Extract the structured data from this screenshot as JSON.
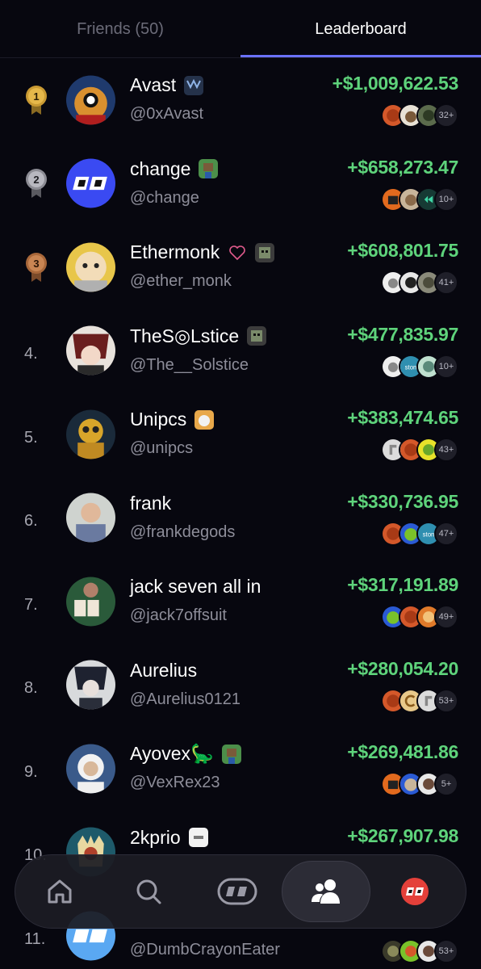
{
  "tabs": {
    "friends": "Friends (50)",
    "leaderboard": "Leaderboard"
  },
  "rows": [
    {
      "rank": "1",
      "name": "Avast",
      "handle": "@0xAvast",
      "pnl": "+$1,009,622.53",
      "count": "32+"
    },
    {
      "rank": "2",
      "name": "change",
      "handle": "@change",
      "pnl": "+$658,273.47",
      "count": "10+"
    },
    {
      "rank": "3",
      "name": "Ethermonk",
      "handle": "@ether_monk",
      "pnl": "+$608,801.75",
      "count": "41+"
    },
    {
      "rank": "4.",
      "name": "TheS◎Lstice",
      "handle": "@The__Solstice",
      "pnl": "+$477,835.97",
      "count": "10+"
    },
    {
      "rank": "5.",
      "name": "Unipcs",
      "handle": "@unipcs",
      "pnl": "+$383,474.65",
      "count": "43+"
    },
    {
      "rank": "6.",
      "name": "frank",
      "handle": "@frankdegods",
      "pnl": "+$330,736.95",
      "count": "47+"
    },
    {
      "rank": "7.",
      "name": "jack seven all in",
      "handle": "@jack7offsuit",
      "pnl": "+$317,191.89",
      "count": "49+"
    },
    {
      "rank": "8.",
      "name": "Aurelius",
      "handle": "@Aurelius0121",
      "pnl": "+$280,054.20",
      "count": "53+"
    },
    {
      "rank": "9.",
      "name": "Ayovex🦕",
      "handle": "@VexRex23",
      "pnl": "+$269,481.86",
      "count": "5+"
    },
    {
      "rank": "10.",
      "name": "2kprio",
      "handle": "",
      "pnl": "+$267,907.98",
      "count": ""
    },
    {
      "rank": "11.",
      "name": "",
      "handle": "@DumbCrayonEater",
      "pnl": "",
      "count": "53+"
    }
  ],
  "token_labels": {
    "ston": "ston"
  },
  "nav": [
    "home-icon",
    "search-icon",
    "logo-icon",
    "friends-icon",
    "profile-icon"
  ],
  "colors": {
    "accent": "#6b72ff",
    "positive": "#5ed37b",
    "background": "#07070f"
  }
}
